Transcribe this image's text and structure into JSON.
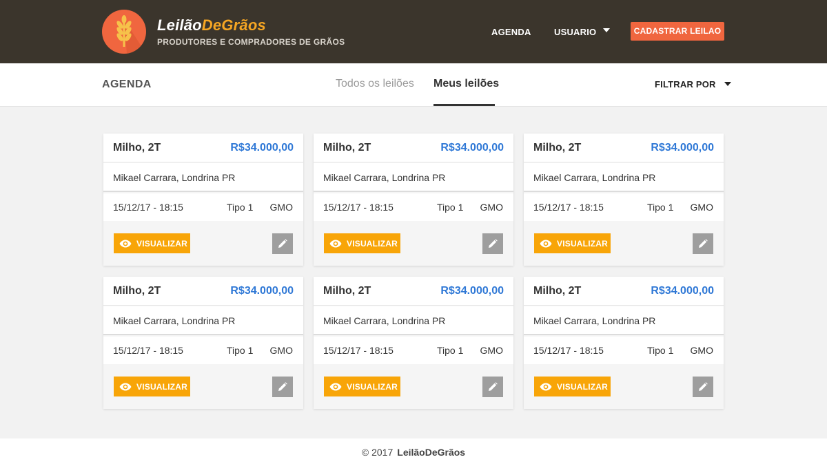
{
  "header": {
    "brand_part1": "Leilão",
    "brand_part2": "DeGrãos",
    "tagline": "PRODUTORES E COMPRADORES DE GRÃOS",
    "nav_agenda": "AGENDA",
    "nav_user": "USUARIO",
    "cta_label": "CADASTRAR LEILAO",
    "colors": {
      "bar": "#3b352c",
      "accent": "#f0663f",
      "brand_accent": "#f6a623"
    }
  },
  "subbar": {
    "title": "AGENDA",
    "tabs": [
      {
        "label": "Todos os leilões",
        "active": false
      },
      {
        "label": "Meus leilões",
        "active": true
      }
    ],
    "filter_label": "FILTRAR POR"
  },
  "cards": [
    {
      "title": "Milho, 2T",
      "price": "R$34.000,00",
      "owner": "Mikael Carrara, Londrina PR",
      "datetime": "15/12/17 - 18:15",
      "type": "Tipo 1",
      "gmo": "GMO",
      "view_label": "VISUALIZAR"
    },
    {
      "title": "Milho, 2T",
      "price": "R$34.000,00",
      "owner": "Mikael Carrara, Londrina PR",
      "datetime": "15/12/17 - 18:15",
      "type": "Tipo 1",
      "gmo": "GMO",
      "view_label": "VISUALIZAR"
    },
    {
      "title": "Milho, 2T",
      "price": "R$34.000,00",
      "owner": "Mikael Carrara, Londrina PR",
      "datetime": "15/12/17 - 18:15",
      "type": "Tipo 1",
      "gmo": "GMO",
      "view_label": "VISUALIZAR"
    },
    {
      "title": "Milho, 2T",
      "price": "R$34.000,00",
      "owner": "Mikael Carrara, Londrina PR",
      "datetime": "15/12/17 - 18:15",
      "type": "Tipo 1",
      "gmo": "GMO",
      "view_label": "VISUALIZAR"
    },
    {
      "title": "Milho, 2T",
      "price": "R$34.000,00",
      "owner": "Mikael Carrara, Londrina PR",
      "datetime": "15/12/17 - 18:15",
      "type": "Tipo 1",
      "gmo": "GMO",
      "view_label": "VISUALIZAR"
    },
    {
      "title": "Milho, 2T",
      "price": "R$34.000,00",
      "owner": "Mikael Carrara, Londrina PR",
      "datetime": "15/12/17 - 18:15",
      "type": "Tipo 1",
      "gmo": "GMO",
      "view_label": "VISUALIZAR"
    }
  ],
  "icons": {
    "logo": "wheat-icon",
    "view": "eye-icon",
    "edit": "pencil-icon",
    "dropdown": "caret-down-icon"
  },
  "footer": {
    "copyright": "© 2017",
    "brand": "LeilãoDeGrãos"
  }
}
